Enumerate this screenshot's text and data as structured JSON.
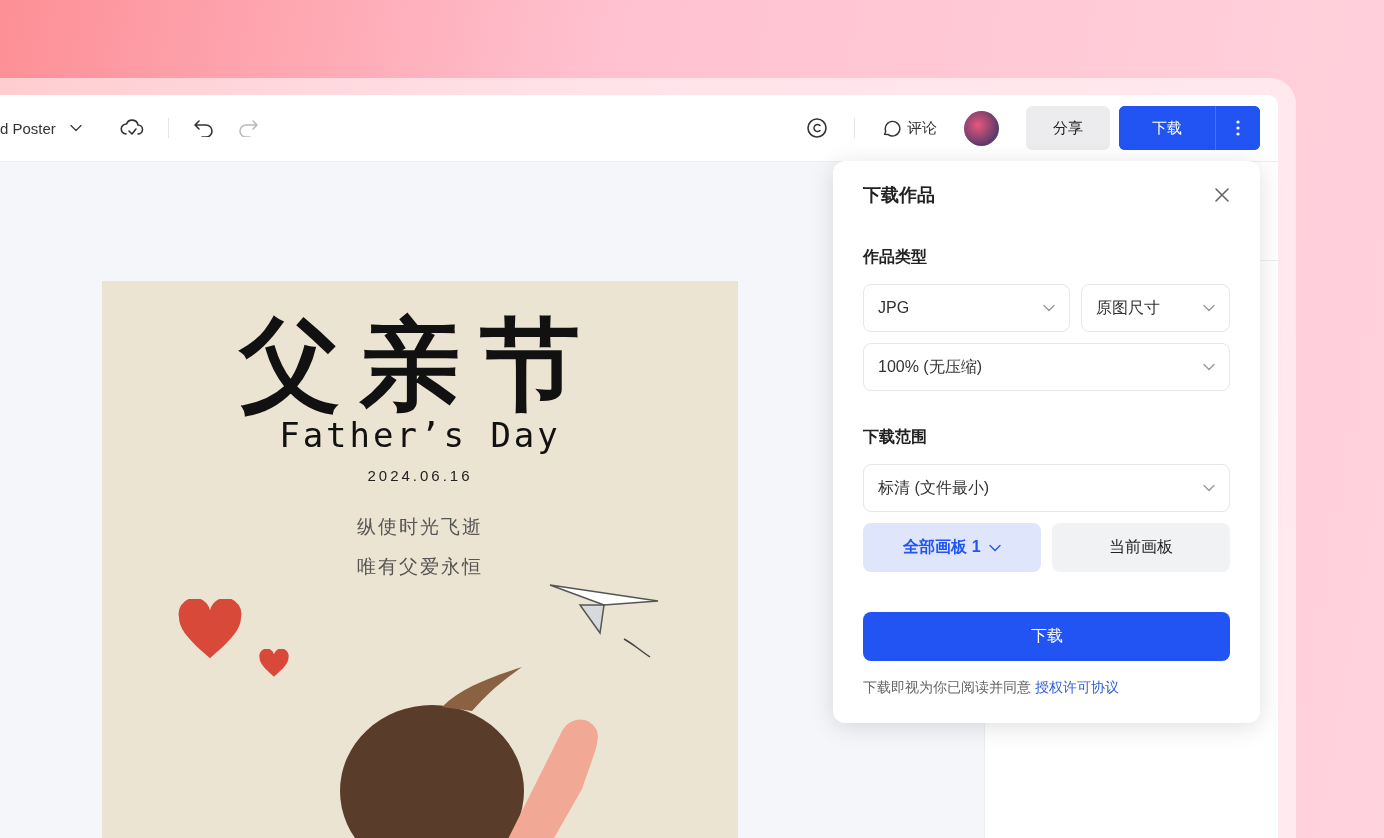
{
  "toolbar": {
    "document_title": "d Poster",
    "undo": {
      "disabled": false
    },
    "redo": {
      "disabled": true
    },
    "comment_label": "评论",
    "share_button": "分享",
    "download_button": "下载"
  },
  "poster": {
    "title": "父亲节",
    "subtitle": "Father’s Day",
    "date": "2024.06.16",
    "lines": [
      "纵使时光飞逝",
      "唯有父爱永恒"
    ]
  },
  "download_panel": {
    "title": "下载作品",
    "type_label": "作品类型",
    "selects": [
      {
        "value": "JPG"
      },
      {
        "value": "原图尺寸"
      },
      {
        "value": "100% (无压缩)"
      }
    ],
    "range_label": "下载范围",
    "quality_select": "标清 (文件最小)",
    "scope_options": [
      {
        "label": "全部画板 1",
        "selected": true
      },
      {
        "label": "当前画板",
        "selected": false
      }
    ],
    "download_button": "下载",
    "agreement_text": "下载即视为你已阅读并同意",
    "agreement_link": "授权许可协议"
  }
}
